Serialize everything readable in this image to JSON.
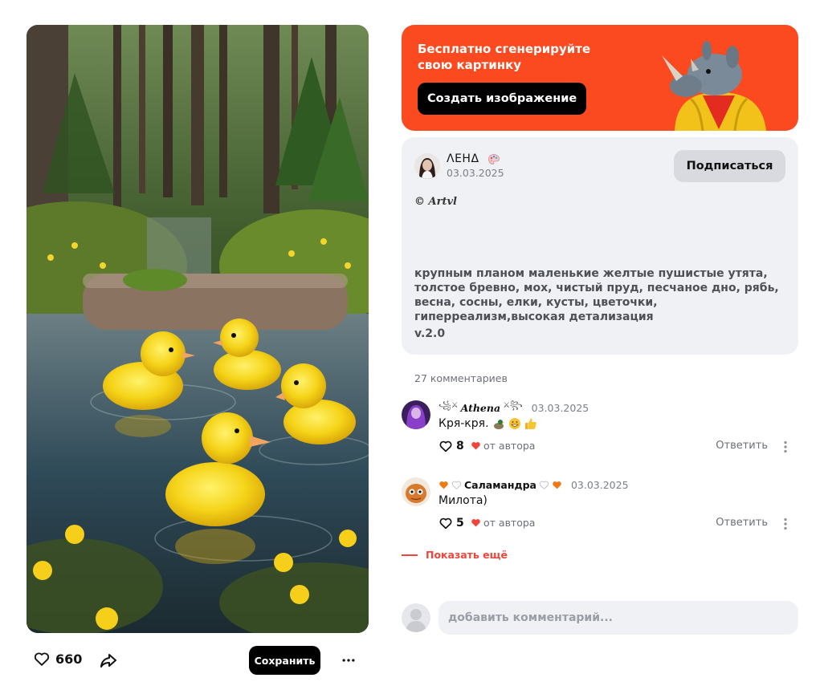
{
  "post": {
    "likes": "660",
    "save_label": "Сохранить",
    "image_alt": "утята в пруду"
  },
  "promo": {
    "title": "Бесплатно сгенерируйте свою картинку",
    "button_label": "Создать изображение",
    "bg_color": "#fb4a1f"
  },
  "author": {
    "name": "ΛΕΗΔ",
    "date": "03.03.2025",
    "subscribe_label": "Подписаться",
    "signature": "© Artvl"
  },
  "description": {
    "text": "крупным планом маленькие желтые пушистые утята, толстое бревно, мох, чистый пруд, песчаное дно, рябь, весна, сосны, елки, кусты, цветочки, гиперреализм,высокая детализация",
    "version": "v.2.0"
  },
  "comments": {
    "count_label": "27 комментариев",
    "items": [
      {
        "author": "Athena",
        "date": "03.03.2025",
        "text": "Кря-кря.",
        "likes": "8",
        "author_like_label": "от автора",
        "reply_label": "Ответить"
      },
      {
        "author": "Саламандра",
        "date": "03.03.2025",
        "text": "Милота)",
        "likes": "5",
        "author_like_label": "от автора",
        "reply_label": "Ответить"
      }
    ],
    "show_more_label": "Показать ещё",
    "input_placeholder": "добавить комментарий..."
  }
}
